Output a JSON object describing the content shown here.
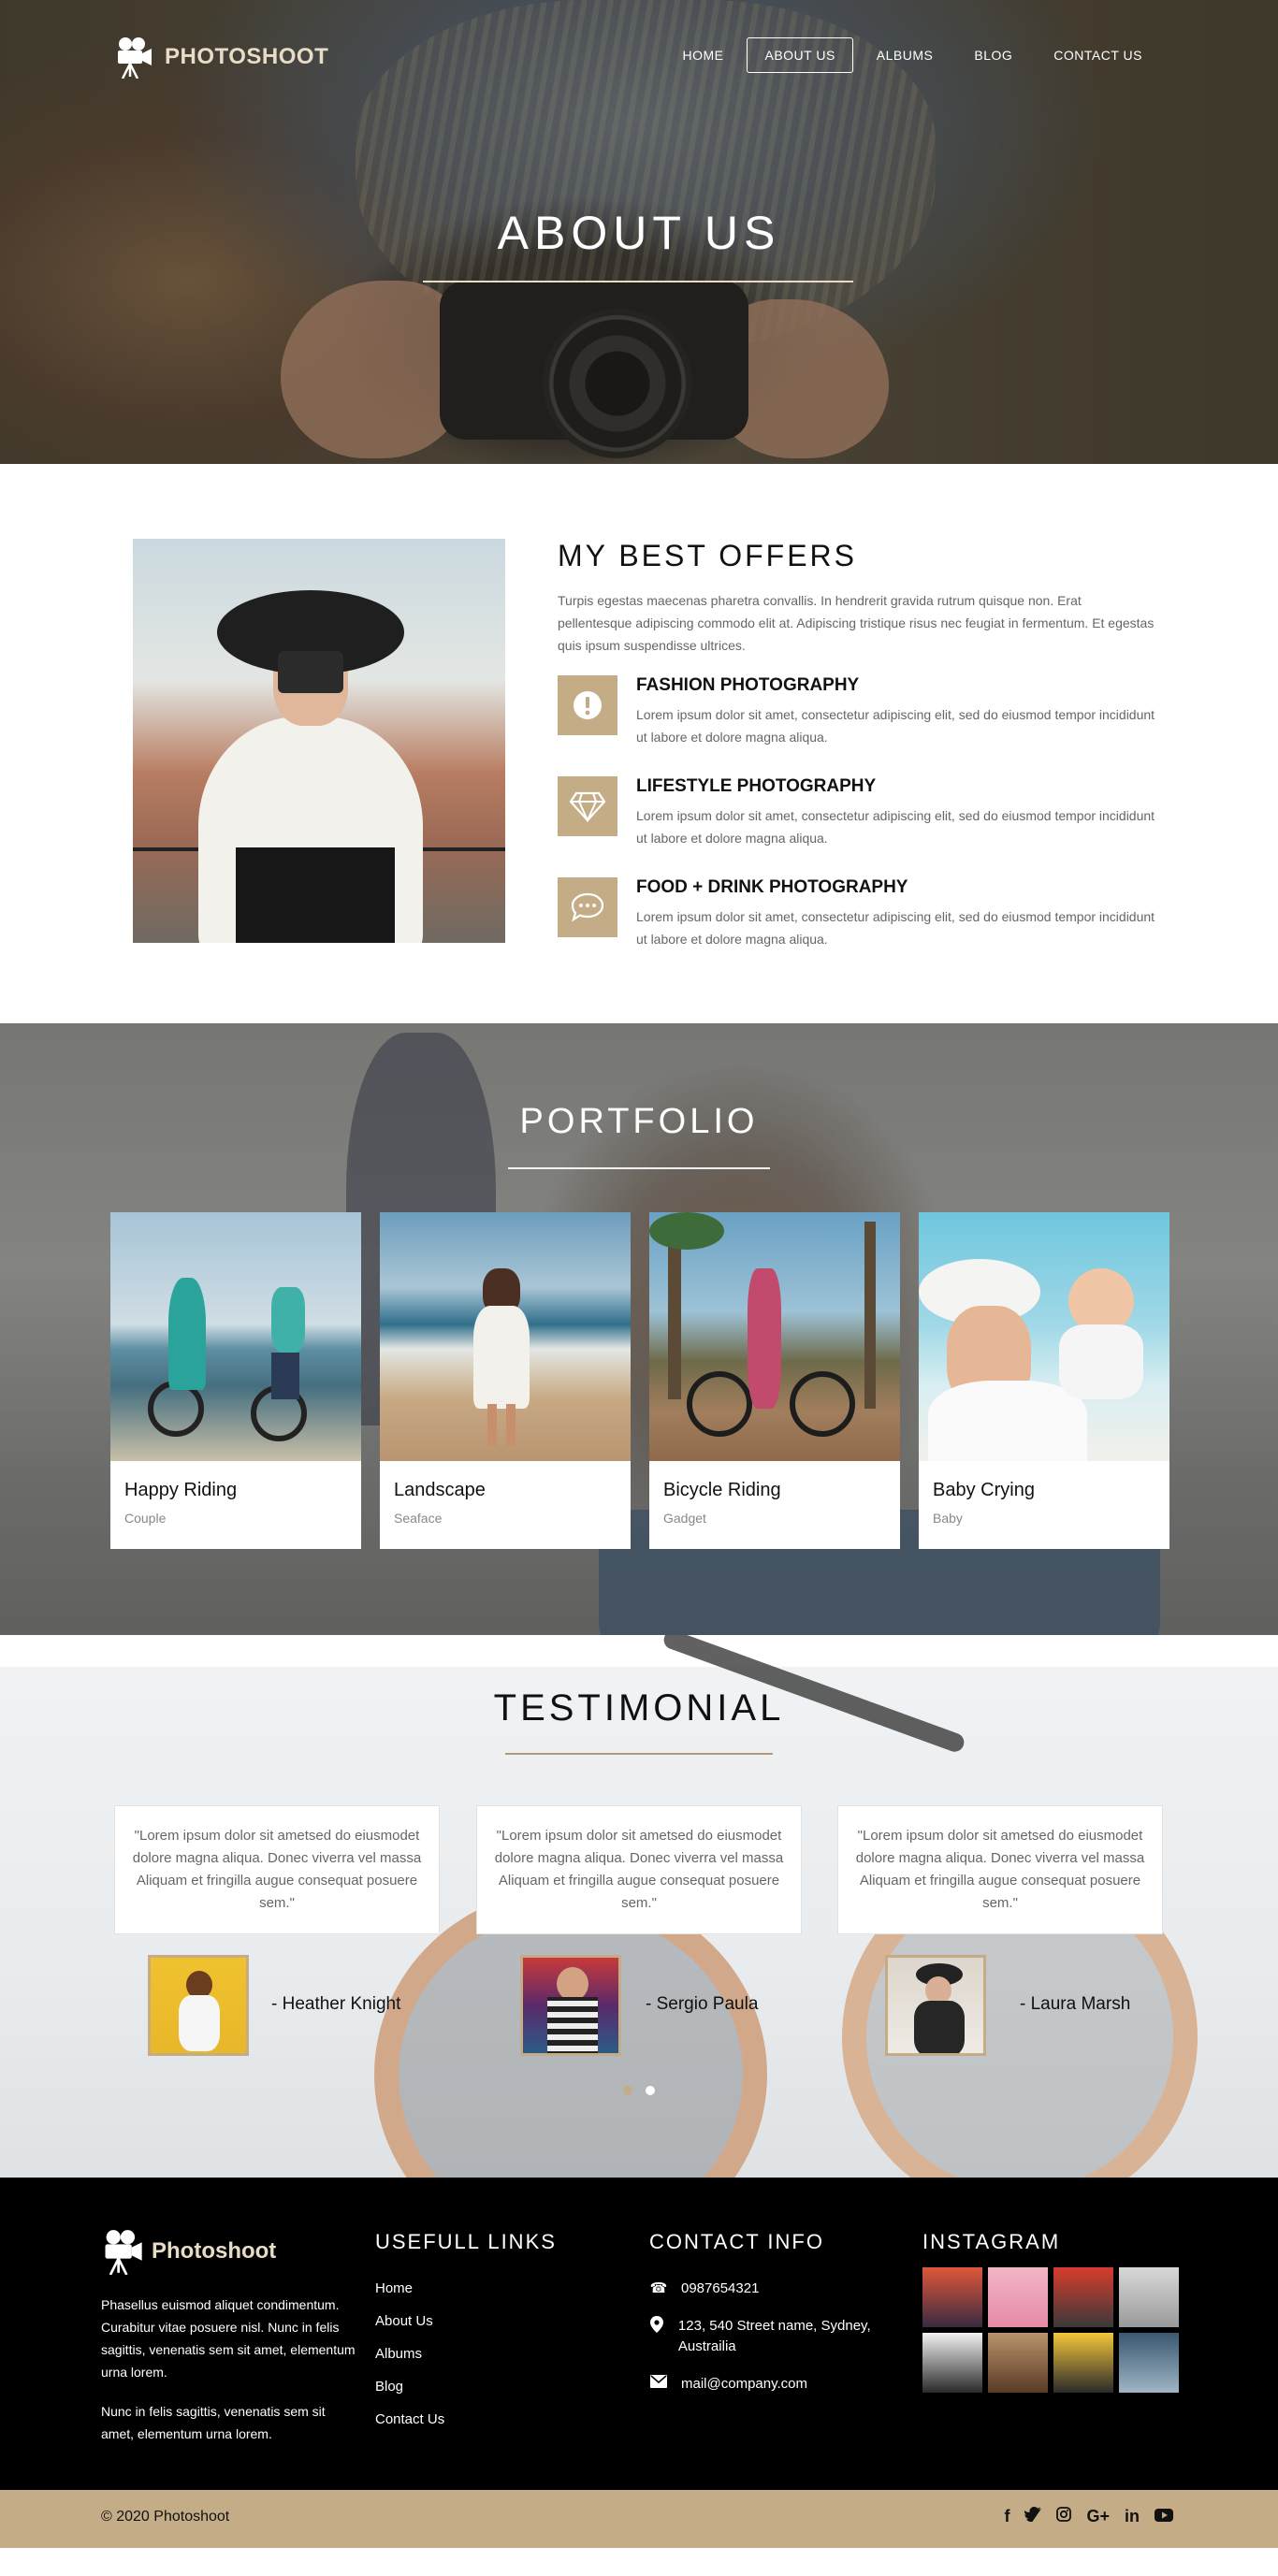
{
  "brand": {
    "name": "PHOTOSHOOT",
    "icon": "movie-camera-icon"
  },
  "nav": {
    "items": [
      "HOME",
      "ABOUT US",
      "ALBUMS",
      "BLOG",
      "CONTACT US"
    ],
    "active": "ABOUT US"
  },
  "hero": {
    "title": "ABOUT US"
  },
  "offers": {
    "heading": "MY BEST OFFERS",
    "description": "Turpis egestas maecenas pharetra convallis. In hendrerit gravida rutrum quisque non. Erat pellentesque adipiscing commodo elit at. Adipiscing tristique risus nec feugiat in fermentum. Et egestas quis ipsum suspendisse ultrices.",
    "items": [
      {
        "icon": "exclamation-icon",
        "title": "FASHION PHOTOGRAPHY",
        "text": "Lorem ipsum dolor sit amet, consectetur adipiscing elit, sed do eiusmod tempor incididunt ut labore et dolore magna aliqua."
      },
      {
        "icon": "diamond-icon",
        "title": "LIFESTYLE PHOTOGRAPHY",
        "text": "Lorem ipsum dolor sit amet, consectetur adipiscing elit, sed do eiusmod tempor incididunt ut labore et dolore magna aliqua."
      },
      {
        "icon": "chat-bubble-icon",
        "title": "FOOD + DRINK PHOTOGRAPHY",
        "text": "Lorem ipsum dolor sit amet, consectetur adipiscing elit, sed do eiusmod tempor incididunt ut labore et dolore magna aliqua."
      }
    ]
  },
  "portfolio": {
    "heading": "PORTFOLIO",
    "cards": [
      {
        "name": "Happy Riding",
        "category": "Couple"
      },
      {
        "name": "Landscape",
        "category": "Seaface"
      },
      {
        "name": "Bicycle Riding",
        "category": "Gadget"
      },
      {
        "name": "Baby Crying",
        "category": "Baby"
      }
    ]
  },
  "testimonial": {
    "heading": "TESTIMONIAL",
    "quotes": [
      {
        "text": "\"Lorem ipsum dolor sit ametsed do eiusmodet dolore magna aliqua. Donec viverra vel massa Aliquam et fringilla augue consequat posuere sem.\"",
        "name": "- Heather Knight"
      },
      {
        "text": "\"Lorem ipsum dolor sit ametsed do eiusmodet dolore magna aliqua. Donec viverra vel massa Aliquam et fringilla augue consequat posuere sem.\"",
        "name": "- Sergio Paula"
      },
      {
        "text": "\"Lorem ipsum dolor sit ametsed do eiusmodet dolore magna aliqua. Donec viverra vel massa Aliquam et fringilla augue consequat posuere sem.\"",
        "name": "- Laura Marsh"
      }
    ],
    "active_dot": 1
  },
  "footer": {
    "brand": "Photoshoot",
    "about": [
      "Phasellus euismod aliquet condimentum. Curabitur vitae posuere nisl. Nunc in felis sagittis, venenatis sem sit amet, elementum urna lorem.",
      "Nunc in felis sagittis, venenatis sem sit amet, elementum urna lorem."
    ],
    "links_heading": "USEFULL LINKS",
    "links": [
      "Home",
      "About Us",
      "Albums",
      "Blog",
      "Contact Us"
    ],
    "contact_heading": "CONTACT INFO",
    "contact": {
      "phone": "0987654321",
      "address": "123, 540 Street name, Sydney, Austrailia",
      "email": "mail@company.com"
    },
    "instagram_heading": "INSTAGRAM",
    "copyright": "© 2020 Photoshoot",
    "social": [
      "facebook-icon",
      "twitter-icon",
      "instagram-icon",
      "google-plus-icon",
      "linkedin-icon",
      "youtube-icon"
    ]
  },
  "colors": {
    "accent": "#c4ad86",
    "logo": "#e8dcc6",
    "footer_bg": "#000000"
  }
}
